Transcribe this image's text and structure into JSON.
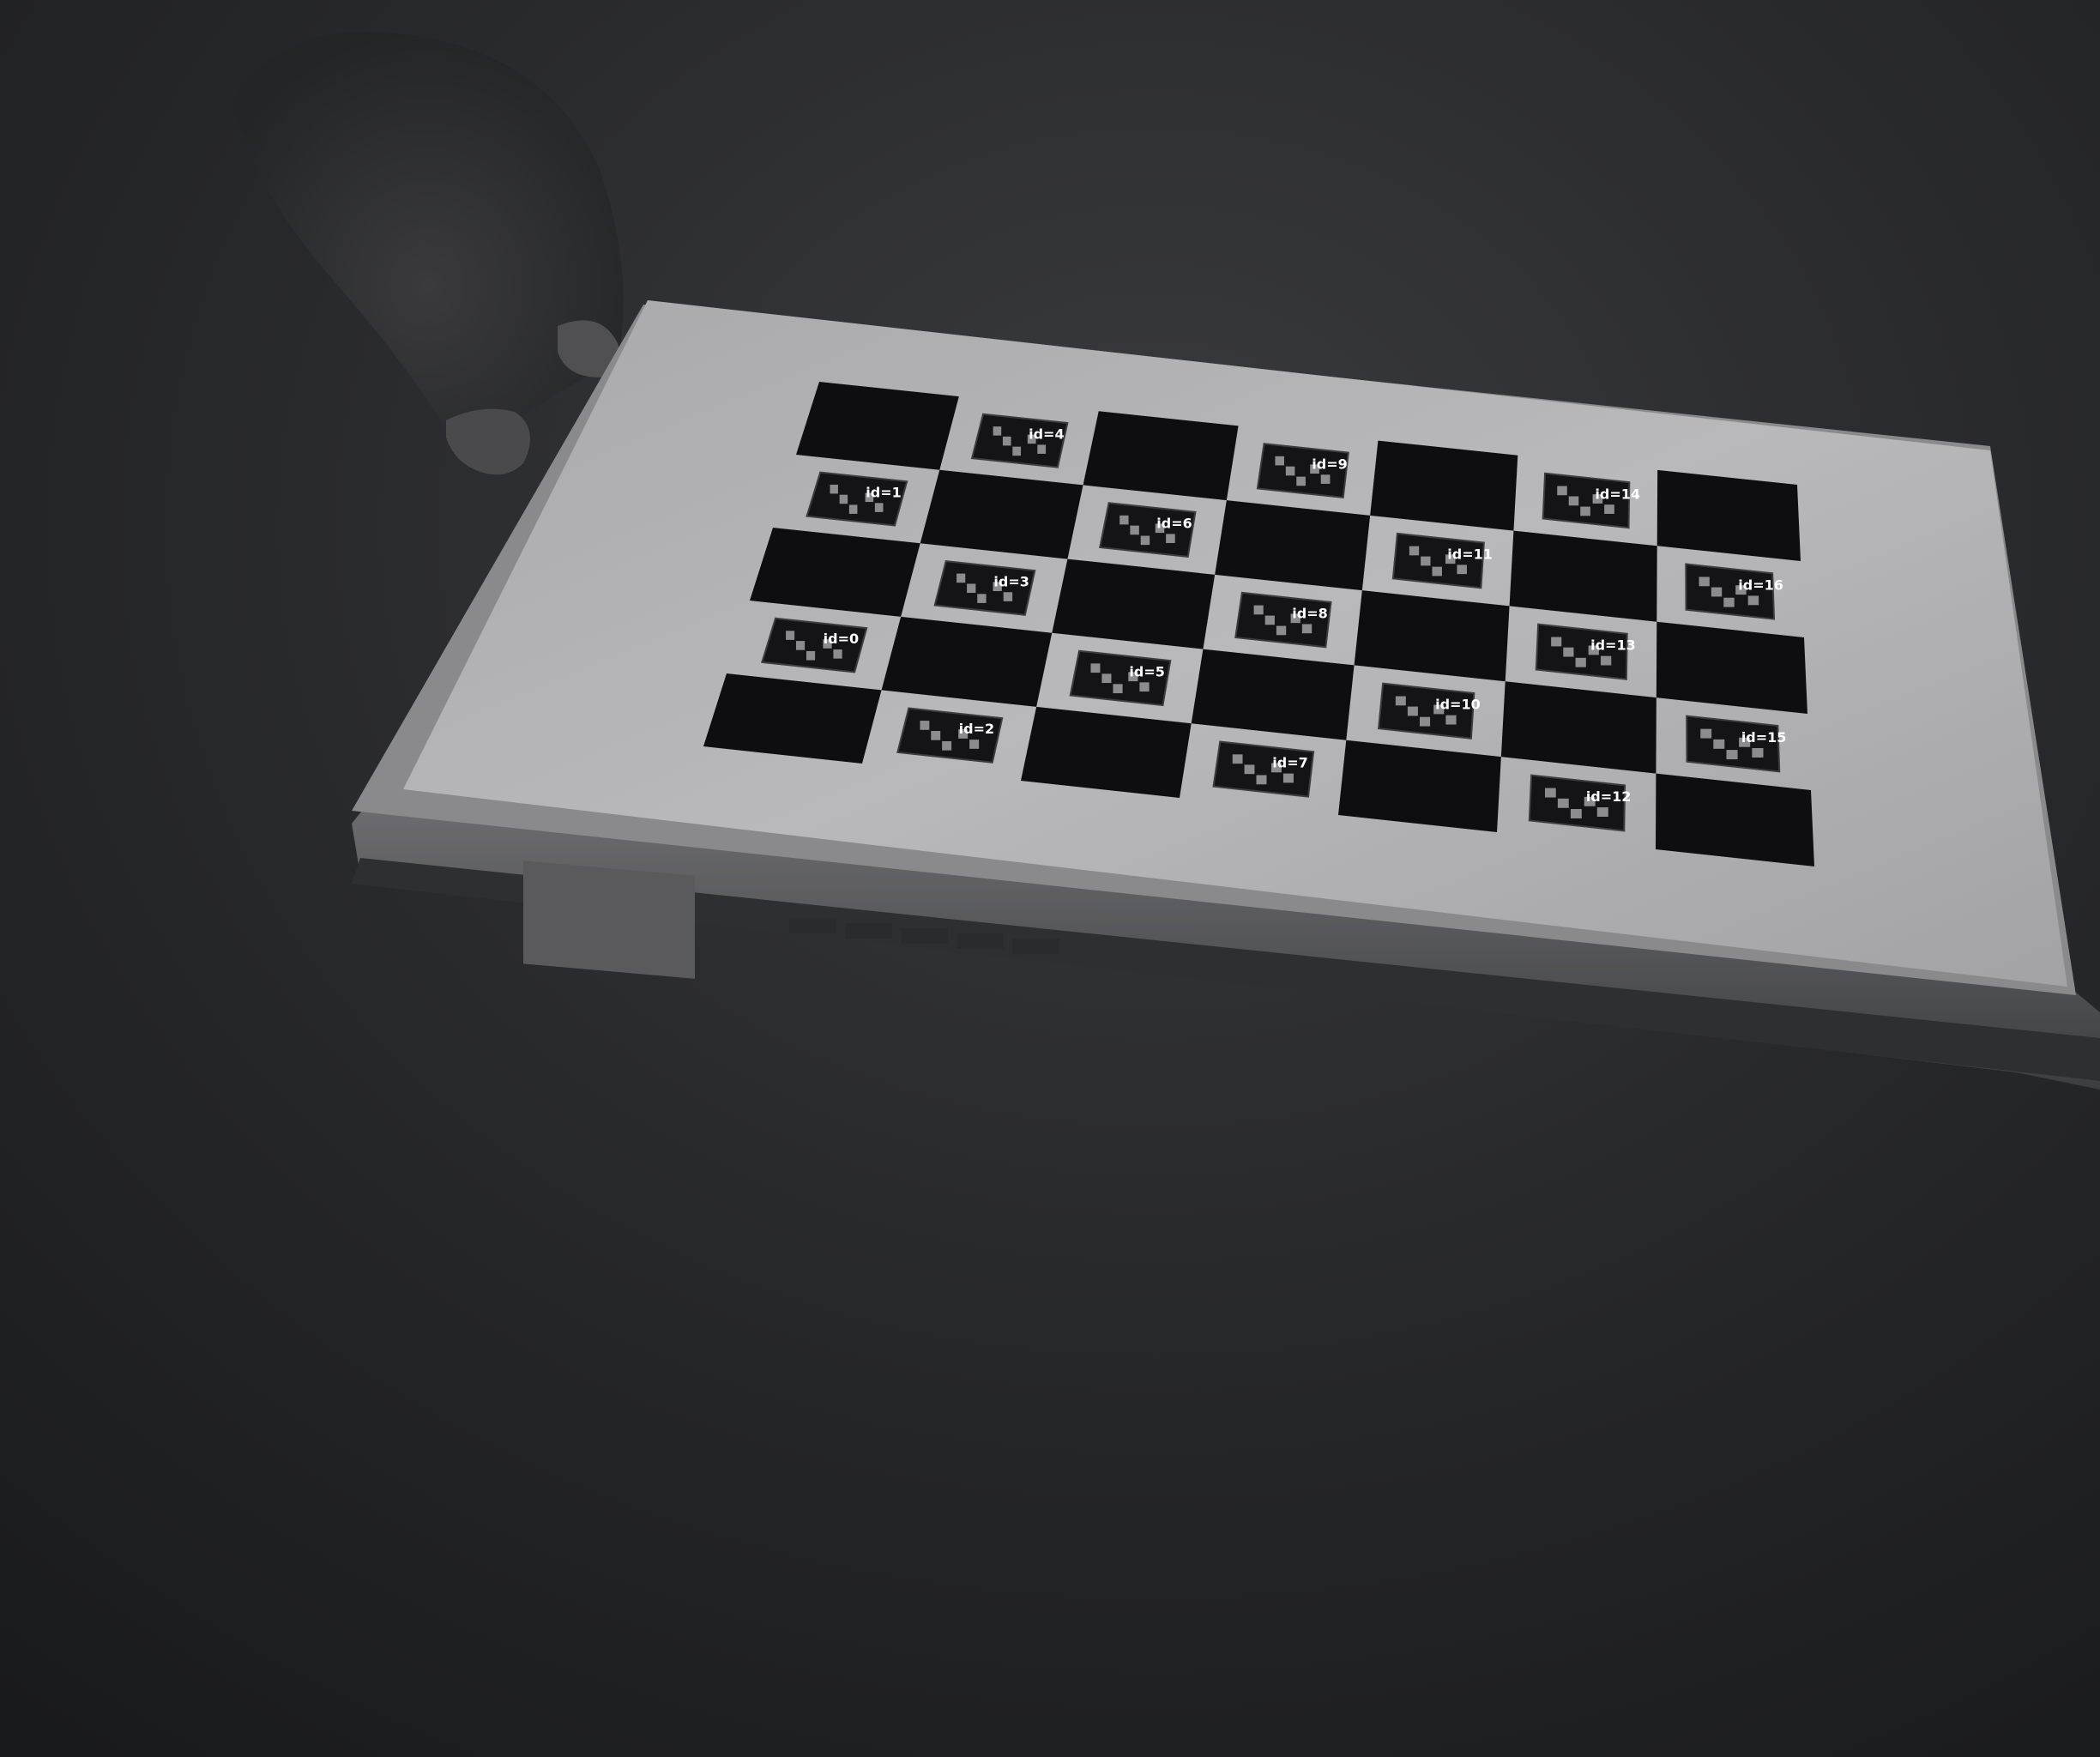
{
  "markers": [
    {
      "id_label": "id=0"
    },
    {
      "id_label": "id=1"
    },
    {
      "id_label": "id=2"
    },
    {
      "id_label": "id=3"
    },
    {
      "id_label": "id=4"
    },
    {
      "id_label": "id=5"
    },
    {
      "id_label": "id=6"
    },
    {
      "id_label": "id=7"
    },
    {
      "id_label": "id=8"
    },
    {
      "id_label": "id=9"
    },
    {
      "id_label": "id=10"
    },
    {
      "id_label": "id=11"
    },
    {
      "id_label": "id=12"
    },
    {
      "id_label": "id=13"
    },
    {
      "id_label": "id=14"
    },
    {
      "id_label": "id=15"
    },
    {
      "id_label": "id=16"
    }
  ]
}
